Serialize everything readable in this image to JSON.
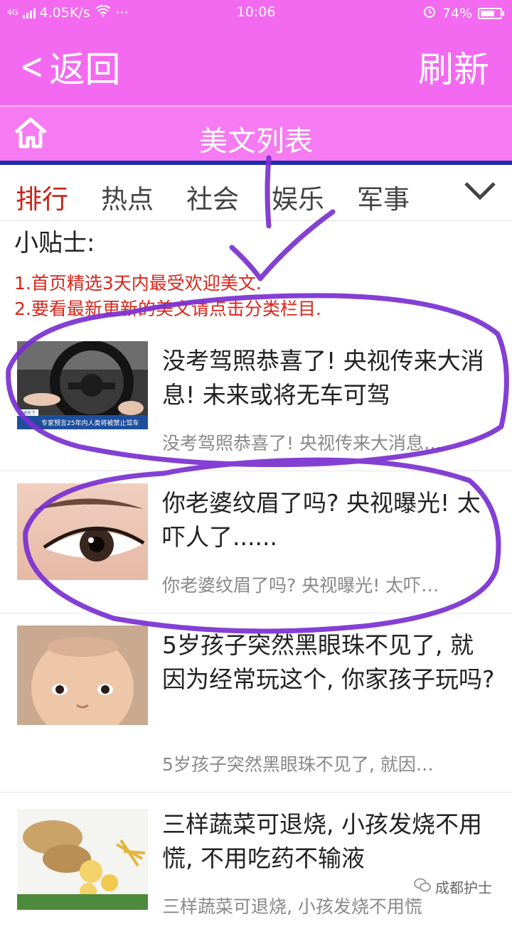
{
  "status_bar": {
    "network_type": "4G",
    "speed": "4.05K/s",
    "more": "···",
    "time": "10:06",
    "battery_percent": "74%",
    "battery_level": 0.74
  },
  "header": {
    "back_label": "返回",
    "refresh_label": "刷新"
  },
  "subheader": {
    "title": "美文列表"
  },
  "tabs": [
    "排行",
    "热点",
    "社会",
    "娱乐",
    "军事"
  ],
  "active_tab": "排行",
  "tips": {
    "heading": "小贴士:",
    "lines": [
      "1.首页精选3天内最受欢迎美文.",
      "2.要看最新更新的美文请点击分类栏目."
    ]
  },
  "articles": [
    {
      "title": "没考驾照恭喜了! 央视传来大消息! 未来或将无车可驾",
      "summary": "没考驾照恭喜了! 央视传来大消息…",
      "thumb_caption": "专家预言25年内人类将被禁止驾车",
      "thumb_tag": "朝闻天下"
    },
    {
      "title": "你老婆纹眉了吗? 央视曝光! 太吓人了......",
      "summary": "你老婆纹眉了吗? 央视曝光! 太吓…"
    },
    {
      "title": "5岁孩子突然黑眼珠不见了, 就因为经常玩这个, 你家孩子玩吗?",
      "summary": "5岁孩子突然黑眼珠不见了, 就因…"
    },
    {
      "title": "三样蔬菜可退烧, 小孩发烧不用慌, 不用吃药不输液",
      "summary": "三样蔬菜可退烧, 小孩发烧不用慌"
    }
  ],
  "watermark": "成都护士",
  "colors": {
    "brand": "#f36af0",
    "active_tab": "#c5241a",
    "tip_text": "#d8261b",
    "annotation": "#7a2fd0"
  }
}
